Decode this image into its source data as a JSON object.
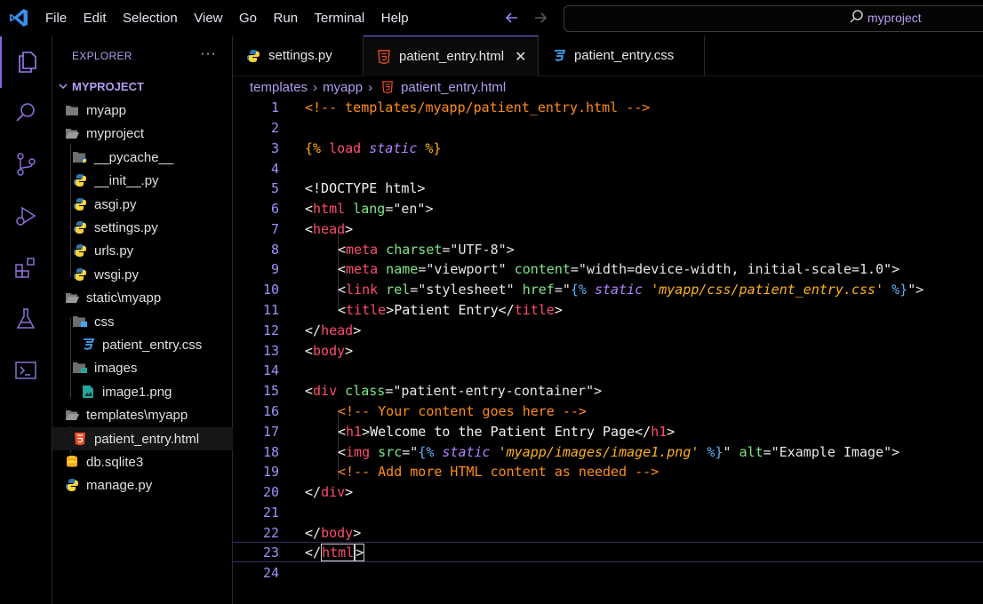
{
  "menu": [
    "File",
    "Edit",
    "Selection",
    "View",
    "Go",
    "Run",
    "Terminal",
    "Help"
  ],
  "search": {
    "text": "myproject"
  },
  "explorer": {
    "title": "EXPLORER",
    "more": "···",
    "project": "MYPROJECT",
    "items": [
      {
        "label": "myapp",
        "type": "folder",
        "depth": 1
      },
      {
        "label": "myproject",
        "type": "folder-open",
        "depth": 1
      },
      {
        "label": "__pycache__",
        "type": "folder-py",
        "depth": 2
      },
      {
        "label": "__init__.py",
        "type": "python",
        "depth": 2
      },
      {
        "label": "asgi.py",
        "type": "python",
        "depth": 2
      },
      {
        "label": "settings.py",
        "type": "python",
        "depth": 2
      },
      {
        "label": "urls.py",
        "type": "python",
        "depth": 2
      },
      {
        "label": "wsgi.py",
        "type": "python",
        "depth": 2
      },
      {
        "label": "static\\myapp",
        "type": "folder-open",
        "depth": 1
      },
      {
        "label": "css",
        "type": "folder-css",
        "depth": 2
      },
      {
        "label": "patient_entry.css",
        "type": "css",
        "depth": 3
      },
      {
        "label": "images",
        "type": "folder-img",
        "depth": 2
      },
      {
        "label": "image1.png",
        "type": "image",
        "depth": 3
      },
      {
        "label": "templates\\myapp",
        "type": "folder-open",
        "depth": 1
      },
      {
        "label": "patient_entry.html",
        "type": "html",
        "depth": 2
      },
      {
        "label": "db.sqlite3",
        "type": "db",
        "depth": 1
      },
      {
        "label": "manage.py",
        "type": "python",
        "depth": 1
      }
    ]
  },
  "tabs": [
    {
      "label": "settings.py",
      "icon": "python-icon"
    },
    {
      "label": "patient_entry.html",
      "icon": "html-icon",
      "close": "✕"
    },
    {
      "label": "patient_entry.css",
      "icon": "css-icon"
    }
  ],
  "breadcrumb": [
    "templates",
    "myapp",
    "patient_entry.html"
  ],
  "line_numbers": [
    "1",
    "2",
    "3",
    "4",
    "5",
    "6",
    "7",
    "8",
    "9",
    "10",
    "11",
    "12",
    "13",
    "14",
    "15",
    "16",
    "17",
    "18",
    "19",
    "20",
    "21",
    "22",
    "23",
    "24"
  ],
  "code": {
    "l1": "<!-- templates/myapp/patient_entry.html -->",
    "l3a": "{% ",
    "l3b": "load",
    "l3c": " static",
    "l3d": " %}",
    "l5": "<!DOCTYPE html>",
    "l6a": "<",
    "l6b": "html",
    "l6c": " lang",
    "l6d": "=\"en\">",
    "l7a": "<",
    "l7b": "head",
    "l7c": ">",
    "l8a": "<",
    "l8b": "meta",
    "l8c": " charset",
    "l8d": "=\"UTF-8\">",
    "l9a": "<",
    "l9b": "meta",
    "l9c": " name",
    "l9d": "=\"viewport\" ",
    "l9e": "content",
    "l9f": "=\"width=device-width, initial-scale=1.0\">",
    "l10a": "<",
    "l10b": "link",
    "l10c": " rel",
    "l10d": "=\"stylesheet\" ",
    "l10e": "href",
    "l10f": "=\"",
    "l10g": "{%",
    "l10h": " static",
    "l10i": " 'myapp/css/patient_entry.css'",
    "l10j": " %}",
    "l10k": "\">",
    "l11a": "<",
    "l11b": "title",
    "l11c": ">Patient Entry</",
    "l11d": "title",
    "l11e": ">",
    "l12a": "</",
    "l12b": "head",
    "l12c": ">",
    "l13a": "<",
    "l13b": "body",
    "l13c": ">",
    "l15a": "<",
    "l15b": "div",
    "l15c": " class",
    "l15d": "=\"patient-entry-container\">",
    "l16": "<!-- Your content goes here -->",
    "l17a": "<",
    "l17b": "h1",
    "l17c": ">Welcome to the Patient Entry Page</",
    "l17d": "h1",
    "l17e": ">",
    "l18a": "<",
    "l18b": "img",
    "l18c": " src",
    "l18d": "=\"",
    "l18e": "{%",
    "l18f": " static",
    "l18g": " 'myapp/images/image1.png'",
    "l18h": " %}",
    "l18i": "\" ",
    "l18j": "alt",
    "l18k": "=\"Example Image\">",
    "l19": "<!-- Add more HTML content as needed -->",
    "l20a": "</",
    "l20b": "div",
    "l20c": ">",
    "l22a": "</",
    "l22b": "body",
    "l22c": ">",
    "l23a": "</",
    "l23b": "html",
    "l23c": ">"
  },
  "colors": {
    "accent": "#8a63e8",
    "comment": "#ff8c1a",
    "tag": "#ff4d6d",
    "attr": "#7ee787"
  }
}
